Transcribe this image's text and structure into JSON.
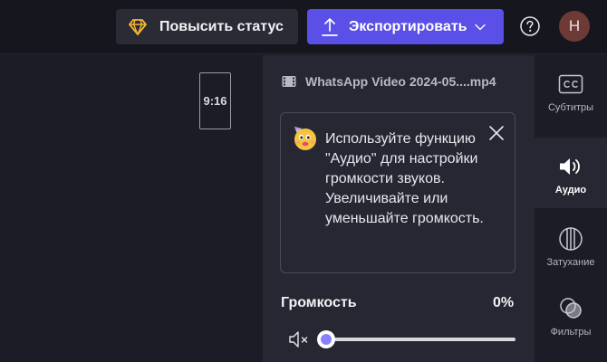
{
  "header": {
    "upgrade_label": "Повысить статус",
    "export_label": "Экспортировать",
    "avatar_initial": "Н",
    "icons": {
      "upgrade": "diamond-icon",
      "export": "upload-icon",
      "export_menu": "chevron-down-icon",
      "help": "help-icon"
    },
    "colors": {
      "export_bg": "#5a4fe6",
      "upgrade_accent": "#f5b731",
      "avatar_bg": "#6e3a36"
    }
  },
  "canvas": {
    "aspect_ratio": "9:16"
  },
  "panel": {
    "file_name": "WhatsApp Video 2024-05....mp4",
    "file_icon": "film-icon",
    "tip": {
      "emoji": "party-face-emoji",
      "text": "Используйте функцию \"Аудио\" для настройки громкости звуков. Увеличивайте или уменьшайте громкость."
    },
    "volume": {
      "label": "Громкость",
      "value_text": "0%",
      "value": 0,
      "mute_icon": "speaker-muted-icon"
    },
    "accent": "#8a80ff"
  },
  "rail": {
    "items": [
      {
        "label": "Субтитры",
        "icon": "captions-icon",
        "active": false
      },
      {
        "label": "Аудио",
        "icon": "speaker-icon",
        "active": true
      },
      {
        "label": "Затухание",
        "icon": "fade-icon",
        "active": false
      },
      {
        "label": "Фильтры",
        "icon": "filters-icon",
        "active": false
      }
    ]
  }
}
